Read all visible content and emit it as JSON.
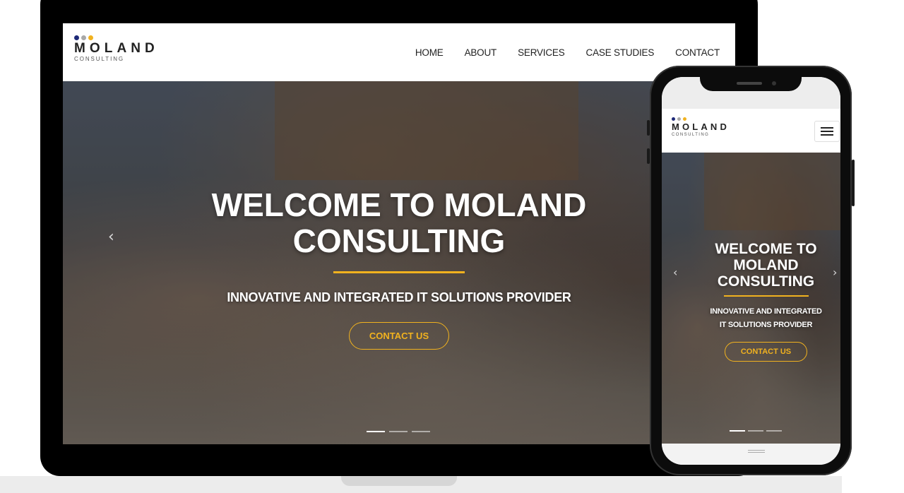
{
  "brand": {
    "name": "MOLAND",
    "tagline": "CONSULTING",
    "dot_colors": [
      "#1e2a78",
      "#a8a8a8",
      "#f1b21f"
    ]
  },
  "nav": {
    "items": [
      "HOME",
      "ABOUT",
      "SERVICES",
      "CASE STUDIES",
      "CONTACT"
    ]
  },
  "hero": {
    "title_line1": "WELCOME TO MOLAND",
    "title_line2": "CONSULTING",
    "subtitle": "INNOVATIVE AND INTEGRATED IT SOLUTIONS PROVIDER",
    "button_label": "CONTACT US",
    "slide_count": 3,
    "active_slide": 1
  },
  "mobile": {
    "title_line1": "WELCOME TO",
    "title_line2": "MOLAND",
    "title_line3": "CONSULTING",
    "subtitle_line1": "INNOVATIVE AND INTEGRATED",
    "subtitle_line2": "IT SOLUTIONS PROVIDER",
    "button_label": "CONTACT US",
    "menu_icon": "hamburger-icon"
  },
  "icons": {
    "prev": "chevron-left-icon",
    "next": "chevron-right-icon"
  },
  "colors": {
    "accent": "#f1b21f",
    "logo_navy": "#1e2a78",
    "logo_gray": "#a8a8a8"
  }
}
